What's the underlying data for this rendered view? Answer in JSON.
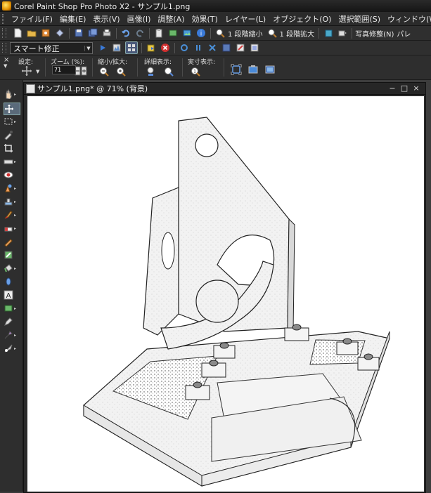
{
  "window": {
    "title": "Corel Paint Shop Pro Photo X2 - サンプル1.png"
  },
  "menu": [
    "ファイル(F)",
    "編集(E)",
    "表示(V)",
    "画像(I)",
    "調整(A)",
    "効果(T)",
    "レイヤー(L)",
    "オブジェクト(O)",
    "選択範囲(S)",
    "ウィンドウ(W)",
    "ヘ"
  ],
  "toolbar1": {
    "step_reduce_label": "1 段階縮小",
    "step_enlarge_label": "1 段階拡大",
    "photo_fix_label": "写真修整(N)",
    "palette_label": "パレ"
  },
  "toolbar2": {
    "smart_fix_value": "スマート修正"
  },
  "options": {
    "preset_label": "設定:",
    "zoom_label": "ズーム (%):",
    "zoom_value": "71",
    "zoom_inout_label": "縮小/拡大:",
    "detail_label": "詳細表示:",
    "actual_label": "実寸表示:"
  },
  "document": {
    "title": "サンプル1.png* @  71% (背景)",
    "minimize": "−",
    "restore": "□",
    "close": "×"
  },
  "colors": {
    "accent": "#4a8fd8",
    "close_red": "#d03030",
    "chrome": "#2e2e2e"
  }
}
